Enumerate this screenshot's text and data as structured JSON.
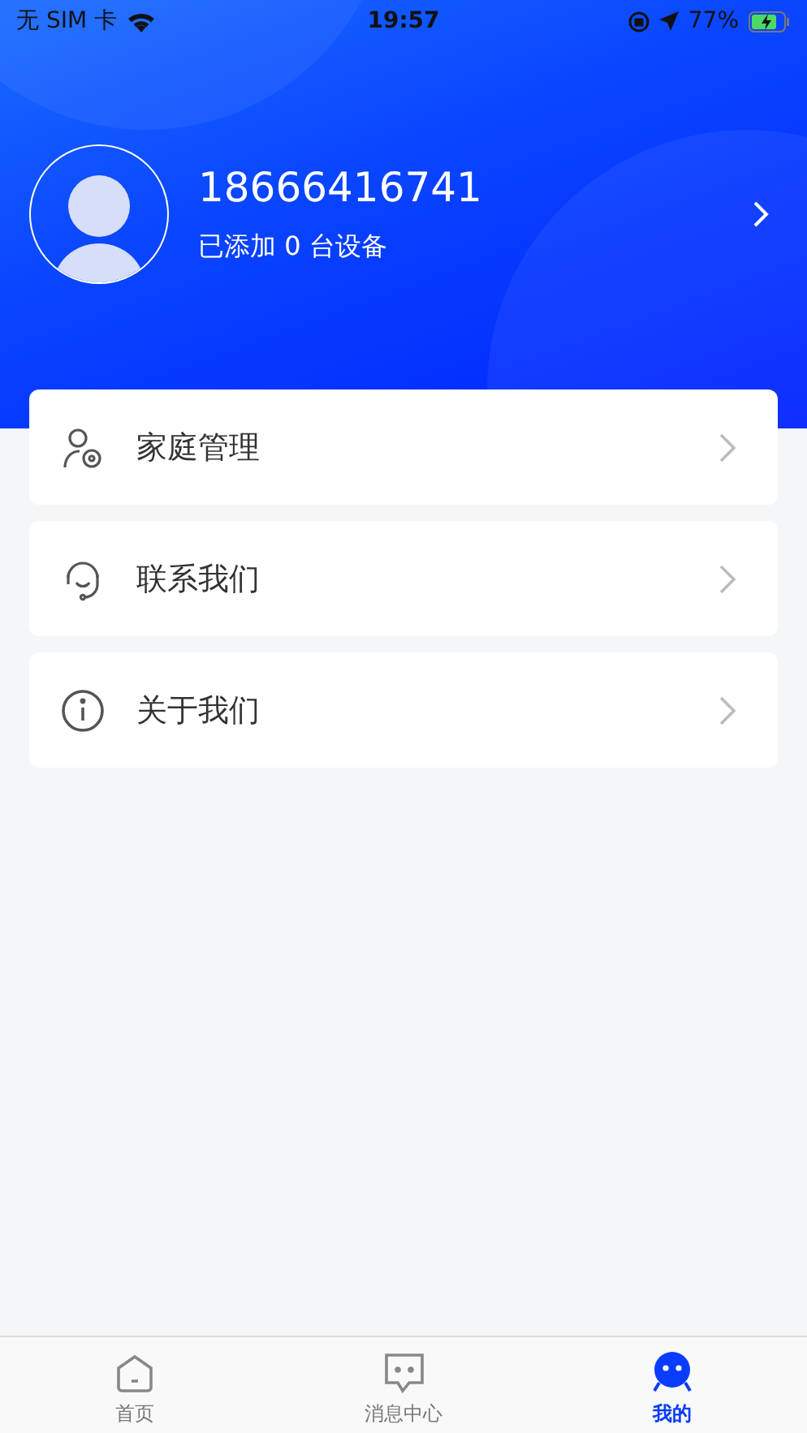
{
  "status_bar": {
    "carrier": "无 SIM 卡",
    "time": "19:57",
    "battery": "77%"
  },
  "profile": {
    "phone": "18666416741",
    "subtitle": "已添加 0 台设备"
  },
  "menu": [
    {
      "kind": "family",
      "label": "家庭管理"
    },
    {
      "kind": "support",
      "label": "联系我们"
    },
    {
      "kind": "info",
      "label": "关于我们"
    }
  ],
  "tabs": [
    {
      "kind": "home",
      "label": "首页",
      "selected": false
    },
    {
      "kind": "message",
      "label": "消息中心",
      "selected": false
    },
    {
      "kind": "me",
      "label": "我的",
      "selected": true
    }
  ]
}
